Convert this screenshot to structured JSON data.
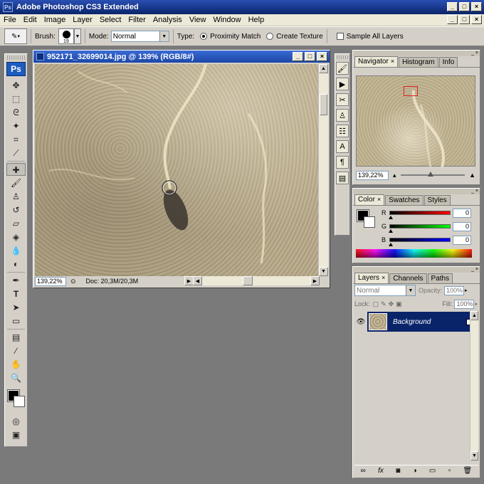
{
  "app": {
    "title": "Adobe Photoshop CS3 Extended",
    "logo": "Ps",
    "title_logo": "Ps"
  },
  "menu": [
    "File",
    "Edit",
    "Image",
    "Layer",
    "Select",
    "Filter",
    "Analysis",
    "View",
    "Window",
    "Help"
  ],
  "options": {
    "brush_label": "Brush:",
    "brush_size": "19",
    "mode_label": "Mode:",
    "mode_value": "Normal",
    "type_label": "Type:",
    "proximity": "Proximity Match",
    "create_texture": "Create Texture",
    "sample_all": "Sample All Layers"
  },
  "document": {
    "title": "952171_32699014.jpg @ 139% (RGB/8#)",
    "zoom": "139,22%",
    "doc_info": "Doc: 20,3M/20,3M"
  },
  "navigator": {
    "tabs": [
      "Navigator",
      "Histogram",
      "Info"
    ],
    "zoom": "139,22%"
  },
  "color": {
    "tabs": [
      "Color",
      "Swatches",
      "Styles"
    ],
    "channels": [
      {
        "label": "R",
        "value": "0"
      },
      {
        "label": "G",
        "value": "0"
      },
      {
        "label": "B",
        "value": "0"
      }
    ],
    "accent_colors": {
      "r": "#cc0000",
      "g": "#00a000",
      "b": "#0000c0"
    }
  },
  "layers": {
    "tabs": [
      "Layers",
      "Channels",
      "Paths"
    ],
    "blend_mode": "Normal",
    "opacity_label": "Opacity:",
    "opacity": "100%",
    "lock_label": "Lock:",
    "fill_label": "Fill:",
    "fill": "100%",
    "layer_name": "Background"
  }
}
